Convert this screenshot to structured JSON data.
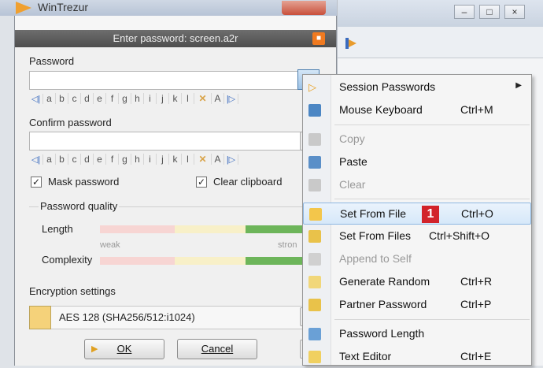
{
  "app": {
    "title": "WinTrezur"
  },
  "dialog": {
    "title": "Enter password: screen.a2r",
    "password_label": "Password",
    "confirm_label": "Confirm password",
    "char_rows": [
      "a",
      "b",
      "c",
      "d",
      "e",
      "f",
      "g",
      "h",
      "i",
      "j",
      "k",
      "l",
      "A"
    ],
    "mask_label": "Mask password",
    "clear_label": "Clear clipboard",
    "quality_label": "Password quality",
    "length_label": "Length",
    "complexity_label": "Complexity",
    "weak_label": "weak",
    "strong_label": "stron",
    "encryption_label": "Encryption settings",
    "encryption_value": "AES 128  (SHA256/512:i1024)",
    "ok_label": "OK",
    "cancel_label": "Cancel"
  },
  "menu": {
    "items": [
      {
        "label": "Session Passwords",
        "shortcut": "",
        "disabled": false,
        "submenu": true,
        "icon": "play-icon"
      },
      {
        "label": "Mouse Keyboard",
        "shortcut": "Ctrl+M",
        "disabled": false,
        "icon": "keyboard-icon"
      },
      {
        "label": "Copy",
        "shortcut": "",
        "disabled": true,
        "icon": "copy-icon"
      },
      {
        "label": "Paste",
        "shortcut": "",
        "disabled": false,
        "icon": "paste-icon"
      },
      {
        "label": "Clear",
        "shortcut": "",
        "disabled": true,
        "icon": "clear-icon"
      },
      {
        "label": "Set From File",
        "shortcut": "Ctrl+O",
        "disabled": false,
        "highlighted": true,
        "icon": "folder-icon"
      },
      {
        "label": "Set From Files",
        "shortcut": "Ctrl+Shift+O",
        "disabled": false,
        "icon": "files-icon"
      },
      {
        "label": "Append to Self",
        "shortcut": "",
        "disabled": true,
        "icon": "append-icon"
      },
      {
        "label": "Generate Random",
        "shortcut": "Ctrl+R",
        "disabled": false,
        "icon": "generate-icon"
      },
      {
        "label": "Partner Password",
        "shortcut": "Ctrl+P",
        "disabled": false,
        "icon": "partner-icon"
      },
      {
        "label": "Password Length",
        "shortcut": "",
        "disabled": false,
        "icon": "length-icon"
      },
      {
        "label": "Text Editor",
        "shortcut": "Ctrl+E",
        "disabled": false,
        "icon": "editor-icon"
      }
    ],
    "badge": "1"
  },
  "colors": {
    "highlight": "#d6e8f9",
    "badge": "#d2232a"
  }
}
